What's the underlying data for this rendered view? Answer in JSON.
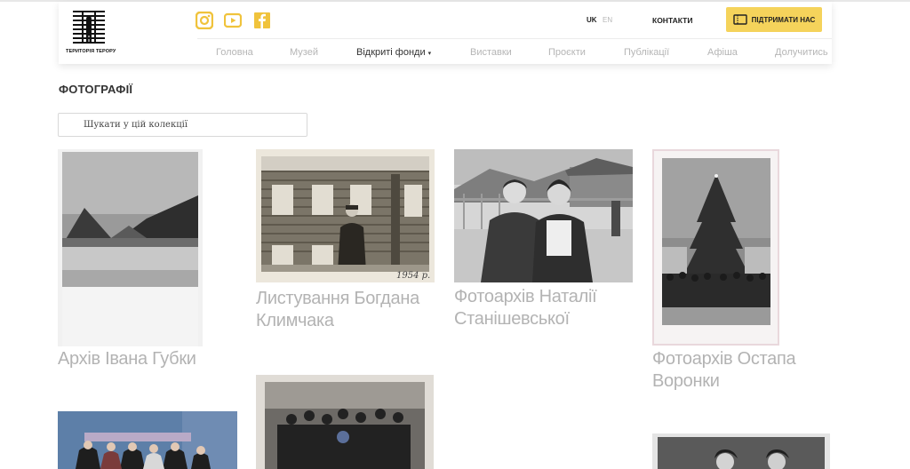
{
  "header": {
    "logo_text": "ТЕРИТОРІЯ ТЕРОРУ",
    "social": [
      "instagram-icon",
      "youtube-icon",
      "facebook-icon"
    ],
    "languages": [
      {
        "code": "UK",
        "active": true
      },
      {
        "code": "EN",
        "active": false
      }
    ],
    "contacts_label": "КОНТАКТИ",
    "support_label": "ПІДТРИМАТИ НАС",
    "nav": [
      {
        "label": "Головна",
        "active": false
      },
      {
        "label": "Музей",
        "active": false
      },
      {
        "label": "Відкриті фонди",
        "active": true,
        "dropdown": true
      },
      {
        "label": "Виставки",
        "active": false
      },
      {
        "label": "Проєкти",
        "active": false
      },
      {
        "label": "Публікації",
        "active": false
      },
      {
        "label": "Афіша",
        "active": false
      },
      {
        "label": "Долучитись",
        "active": false
      }
    ],
    "caret": "▾"
  },
  "page": {
    "title": "ФОТОГРАФІЇ",
    "search_placeholder": "Шукати у цій колекції"
  },
  "collections": [
    {
      "title": "Архів Івана Губки"
    },
    {
      "title": "Листування Богдана Климчака",
      "photo_caption": "1954 р."
    },
    {
      "title": "Фотоархів Наталії Станішевської"
    },
    {
      "title": "Фотоархів Остапа Воронки"
    }
  ],
  "colors": {
    "accent": "#f5d35b",
    "muted_text": "#b3b3b3",
    "dark_text": "#333333"
  }
}
